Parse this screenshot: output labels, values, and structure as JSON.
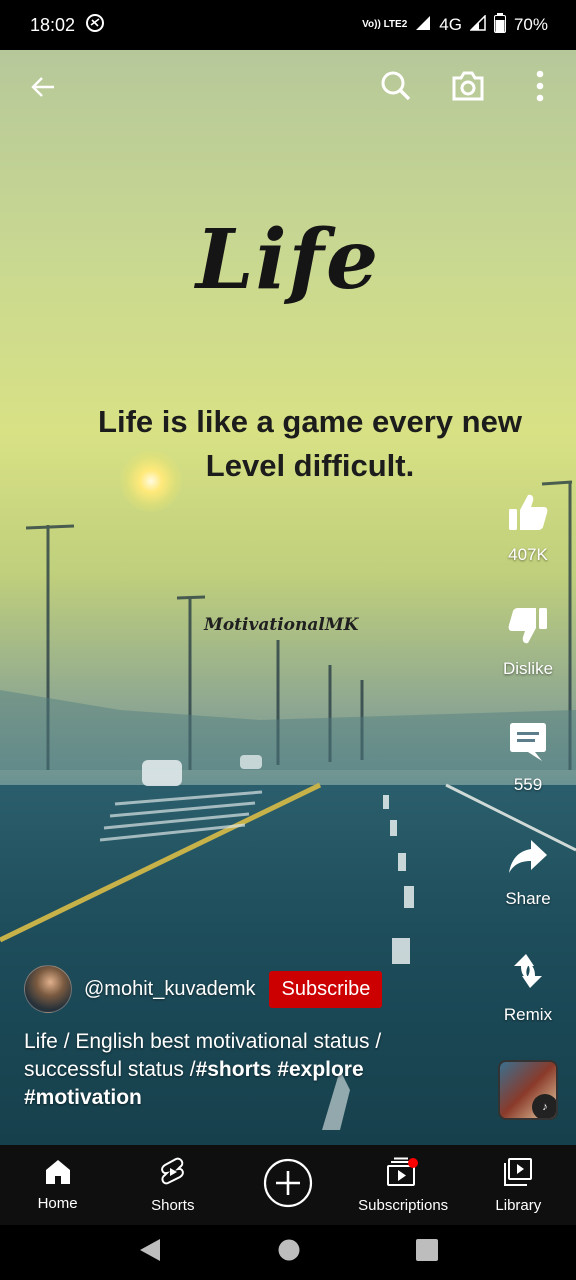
{
  "status_bar": {
    "time": "18:02",
    "volte": "Vo)) LTE2",
    "network": "4G",
    "battery": "70%"
  },
  "video": {
    "overlay_title": "Life",
    "overlay_quote": "Life is like a game every new Level difficult.",
    "watermark": "MotivationalMK"
  },
  "top_actions": [
    "back-icon",
    "search-icon",
    "camera-icon",
    "more-vert-icon"
  ],
  "actions": {
    "like_count": "407K",
    "dislike_label": "Dislike",
    "comment_count": "559",
    "share_label": "Share",
    "remix_label": "Remix"
  },
  "channel": {
    "handle": "@mohit_kuvademk",
    "subscribe_label": "Subscribe"
  },
  "description": {
    "text": "Life / English best motivational status / successful status /",
    "hashtags": [
      "#shorts",
      "#explore",
      "#motivation"
    ]
  },
  "bottom_nav": [
    {
      "label": "Home",
      "icon": "home-icon"
    },
    {
      "label": "Shorts",
      "icon": "shorts-icon"
    },
    {
      "label": "",
      "icon": "create-icon"
    },
    {
      "label": "Subscriptions",
      "icon": "subscriptions-icon"
    },
    {
      "label": "Library",
      "icon": "library-icon"
    }
  ],
  "colors": {
    "subscribe_red": "#cc0000",
    "notification_dot": "#ff0000",
    "nav_bg": "#0f0f0f"
  }
}
